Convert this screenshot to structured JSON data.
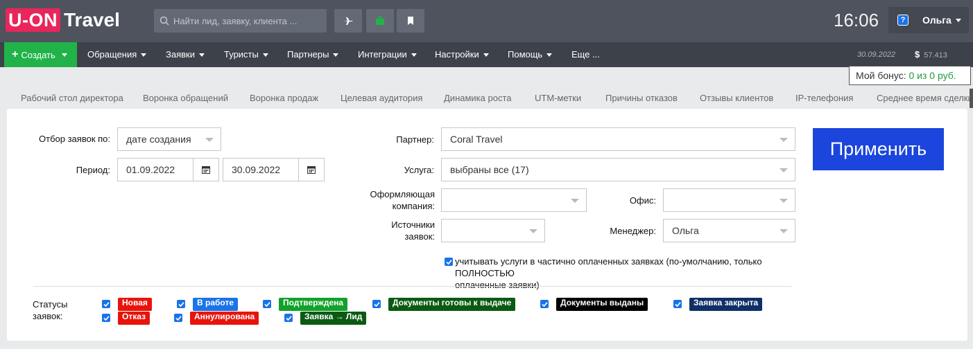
{
  "header": {
    "logo_part1": "U-ON",
    "logo_part2": "Travel",
    "search_placeholder": "Найти лид, заявку, клиента ...",
    "clock": "16:06",
    "help_glyph": "?",
    "user_name": "Ольга",
    "icons": [
      "plane-icon",
      "briefcase-icon",
      "bookmark-icon"
    ],
    "accent_colors": {
      "brand": "#e8265b",
      "create": "#21b34a",
      "apply": "#1b45dc"
    }
  },
  "nav": {
    "create_label": "Создать",
    "items": [
      "Обращения",
      "Заявки",
      "Туристы",
      "Партнеры",
      "Интеграции",
      "Настройки",
      "Помощь",
      "Еще ..."
    ],
    "date": "30.09.2022",
    "currency": "$",
    "balance": "57.413"
  },
  "bonus": {
    "label": "Мой бонус:",
    "value": "0 из 0 руб."
  },
  "tabs": [
    "Рабочий стол директора",
    "Воронка обращений",
    "Воронка продаж",
    "Целевая аудитория",
    "Динамика роста",
    "UTM-метки",
    "Причины отказов",
    "Отзывы клиентов",
    "IP-телефония",
    "Среднее время сделки"
  ],
  "filters": {
    "selection_label": "Отбор заявок по:",
    "selection_value": "дате создания",
    "period_label": "Период:",
    "date_from": "01.09.2022",
    "date_to": "30.09.2022",
    "partner_label": "Партнер:",
    "partner_value": "Coral Travel",
    "service_label": "Услуга:",
    "service_value": "выбраны все (17)",
    "company_label_1": "Оформляющая",
    "company_label_2": "компания:",
    "company_value": "",
    "office_label": "Офис:",
    "office_value": "",
    "sources_label_1": "Источники",
    "sources_label_2": "заявок:",
    "sources_value": "",
    "manager_label": "Менеджер:",
    "manager_value": "Ольга",
    "partial_note_1": "учитывать услуги в частично оплаченных заявках (по-умолчанию, только ПОЛНОСТЬЮ",
    "partial_note_2": "оплаченные заявки)",
    "apply_label": "Применить"
  },
  "statuses": {
    "label_1": "Статусы",
    "label_2": "заявок:",
    "items": [
      {
        "label": "Новая",
        "color": "#e8140c"
      },
      {
        "label": "В работе",
        "color": "#1a73e8"
      },
      {
        "label": "Подтверждена",
        "color": "#12a12a"
      },
      {
        "label": "Документы готовы к выдаче",
        "color": "#0b5a12"
      },
      {
        "label": "Документы выданы",
        "color": "#000000"
      },
      {
        "label": "Заявка закрыта",
        "color": "#0f2f66"
      },
      {
        "label": "Отказ",
        "color": "#e8140c"
      },
      {
        "label": "Аннулирована",
        "color": "#e8140c"
      },
      {
        "label": "Заявка → Лид",
        "color": "#0b5a12"
      }
    ]
  }
}
